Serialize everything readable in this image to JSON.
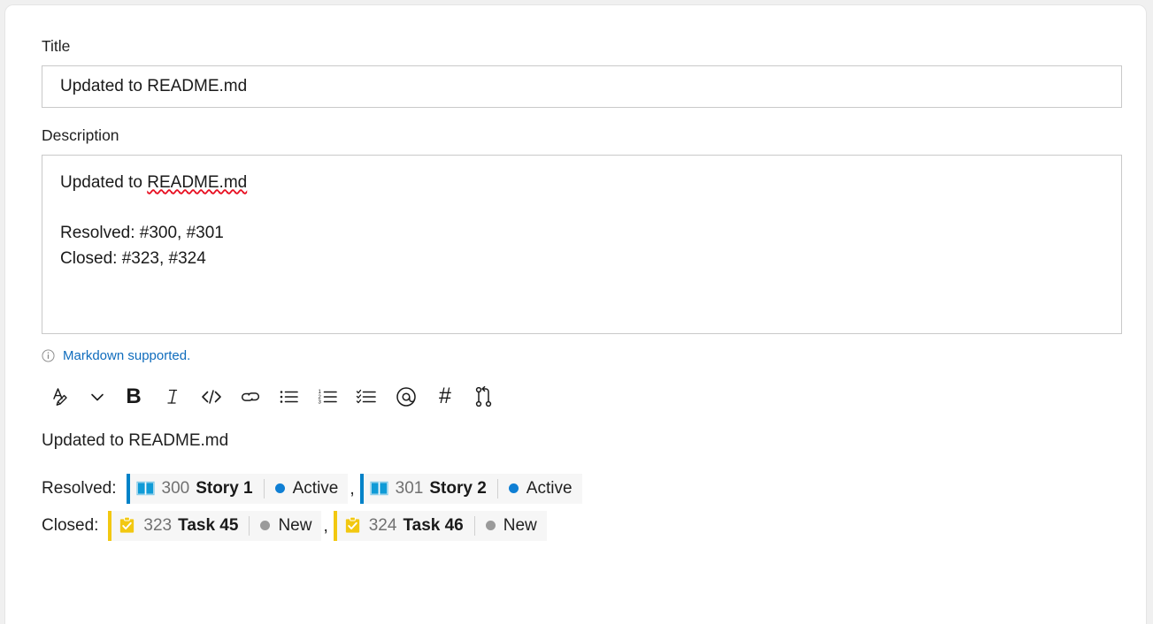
{
  "form": {
    "title_label": "Title",
    "title_value": "Updated to README.md",
    "description_label": "Description",
    "description_lines": [
      "Updated to README.md",
      "",
      "Resolved: #300, #301",
      "Closed: #323, #324"
    ],
    "description_text_prefix": "Updated to ",
    "description_spellcheck_word": "README.md",
    "description_line_resolved": "Resolved: #300, #301",
    "description_line_closed": "Closed: #323, #324",
    "markdown_note": "Markdown supported.",
    "info_icon": "info-circle-icon"
  },
  "toolbar": {
    "items": [
      {
        "name": "text-style-icon",
        "label": "A"
      },
      {
        "name": "chevron-down-icon",
        "label": "⌄"
      },
      {
        "name": "bold-icon",
        "label": "B"
      },
      {
        "name": "italic-icon",
        "label": "I"
      },
      {
        "name": "code-icon",
        "label": "</>"
      },
      {
        "name": "link-icon",
        "label": "⚭"
      },
      {
        "name": "bulleted-list-icon",
        "label": "☰"
      },
      {
        "name": "numbered-list-icon",
        "label": "1≡2"
      },
      {
        "name": "checklist-icon",
        "label": "✓≡"
      },
      {
        "name": "mention-icon",
        "label": "@"
      },
      {
        "name": "hashtag-icon",
        "label": "#"
      },
      {
        "name": "branch-icon",
        "label": "⑂"
      }
    ]
  },
  "preview": {
    "heading": "Updated to README.md",
    "rows": [
      {
        "label": "Resolved:",
        "chips": [
          {
            "type": "story",
            "icon": "book-icon",
            "id": "300",
            "name": "Story 1",
            "state": "Active",
            "state_color": "#0f7fd4",
            "bar_color": "#0082c8"
          },
          {
            "type": "story",
            "icon": "book-icon",
            "id": "301",
            "name": "Story 2",
            "state": "Active",
            "state_color": "#0f7fd4",
            "bar_color": "#0082c8"
          }
        ],
        "separator": ","
      },
      {
        "label": "Closed:",
        "chips": [
          {
            "type": "task",
            "icon": "clipboard-check-icon",
            "id": "323",
            "name": "Task 45",
            "state": "New",
            "state_color": "#9a9a9a",
            "bar_color": "#f2c811"
          },
          {
            "type": "task",
            "icon": "clipboard-check-icon",
            "id": "324",
            "name": "Task 46",
            "state": "New",
            "state_color": "#9a9a9a",
            "bar_color": "#f2c811"
          }
        ],
        "separator": ","
      }
    ]
  },
  "colors": {
    "link": "#0f6cbd",
    "story_accent": "#0082c8",
    "task_accent": "#f2c811",
    "active_state": "#0f7fd4",
    "new_state": "#9a9a9a",
    "field_border": "#c9c9c9",
    "chip_bg": "#f6f6f6",
    "page_bg": "#f0f0f0"
  }
}
